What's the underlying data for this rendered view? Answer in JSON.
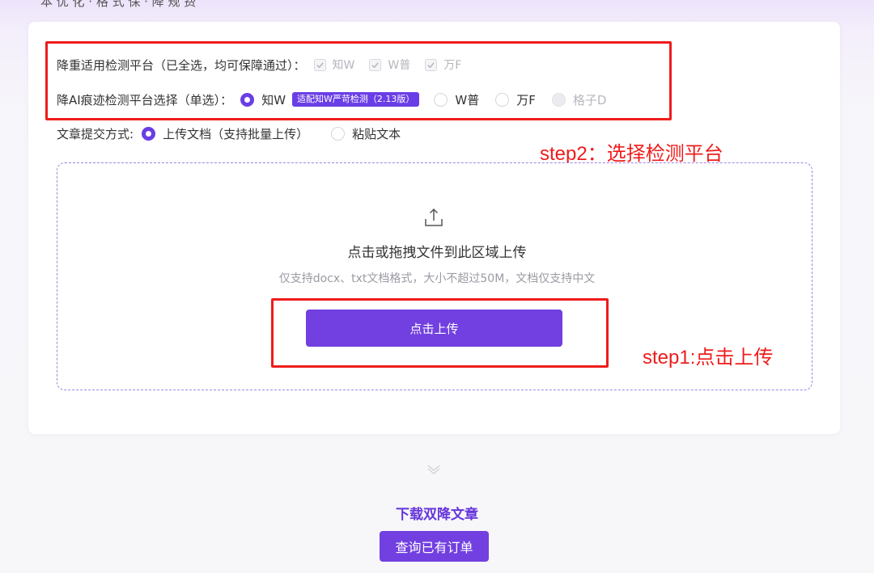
{
  "top_partial_text": "本 优 化 · 格 式 保 · 降 规 费",
  "detection_platforms": {
    "label": "降重适用检测平台（已全选，均可保障通过）：",
    "options": [
      {
        "label": "知W",
        "checked": true,
        "disabled": true
      },
      {
        "label": "W普",
        "checked": true,
        "disabled": true
      },
      {
        "label": "万F",
        "checked": true,
        "disabled": true
      }
    ]
  },
  "ai_platform": {
    "label": "降AI痕迹检测平台选择（单选）：",
    "options": [
      {
        "label": "知W",
        "selected": true,
        "badge": "适配知W严苛检测（2.13版）"
      },
      {
        "label": "W普",
        "selected": false
      },
      {
        "label": "万F",
        "selected": false
      },
      {
        "label": "格子D",
        "selected": false,
        "disabled": true
      }
    ]
  },
  "submit_method": {
    "label": "文章提交方式:",
    "options": [
      {
        "label": "上传文档（支持批量上传）",
        "selected": true
      },
      {
        "label": "粘贴文本",
        "selected": false
      }
    ]
  },
  "annotations": {
    "step2": "step2：选择检测平台",
    "step1": "step1:点击上传"
  },
  "dropzone": {
    "icon": "upload-icon",
    "title": "点击或拖拽文件到此区域上传",
    "hint": "仅支持docx、txt文档格式，大小不超过50M，文档仅支持中文",
    "button_label": "点击上传"
  },
  "footer": {
    "chevron_icon": "chevron-down-icon",
    "download_label": "下载双降文章",
    "query_button_label": "查询已有订单"
  },
  "colors": {
    "accent": "#7240e0",
    "annotation_red": "#ee1c1c",
    "dropzone_border": "#9b84e6"
  }
}
